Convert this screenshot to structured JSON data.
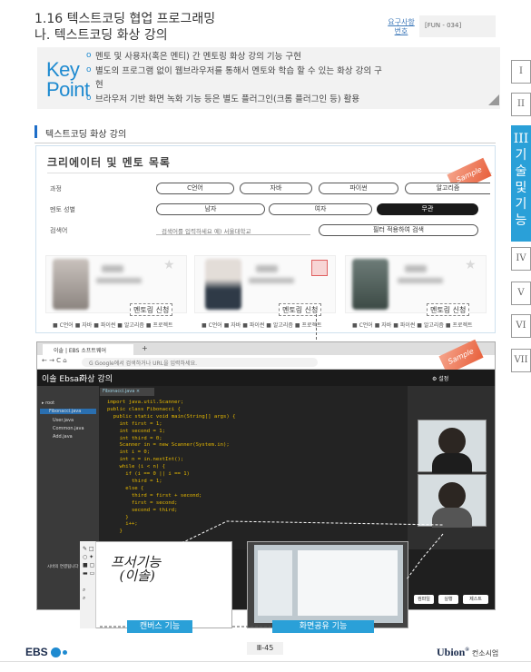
{
  "header": {
    "title": "1.16 텍스트코딩 협업 프로그래밍",
    "subtitle": "나. 텍스트코딩 화상 강의",
    "req_label": "요구사항 번호",
    "req_code": "[FUN - 034]"
  },
  "keypoint": {
    "label_line1": "Key",
    "label_line2": "Point",
    "items": [
      "멘토 및 사용자(혹은 멘티) 간 멘토링 화상 강의 기능 구현",
      "별도의 프로그램 없이 웹브라우저를 통해서 멘토와 학습 할 수 있는 화상 강의 구",
      "현",
      "브라우저 기반 화면 녹화 기능 등은 별도 플러그인(크롬 플러그인 등) 활용"
    ]
  },
  "side_tabs": {
    "t1": "I",
    "t2": "II",
    "active": "III\n기\n술\n및\n기\n능",
    "t4": "IV",
    "t5": "V",
    "t6": "VI",
    "t7": "VII"
  },
  "section": {
    "title": "텍스트코딩 화상 강의"
  },
  "mentor_list": {
    "title": "크리에이터 및 멘토 목록",
    "row_course": "과정",
    "row_gender": "멘토 성별",
    "row_search": "검색어",
    "courses": [
      "C언어",
      "자바",
      "파이썬",
      "알고리즘"
    ],
    "genders": [
      "남자",
      "여자",
      "무관"
    ],
    "search_placeholder": "검색어를 입력하세요 예) 서울대학교",
    "filter_button": "필터 적용하여 검색",
    "mentor_button": "멘토링 신청",
    "tags_prefix": "■ C언어 ■ 자바 ■ 파이썬 ■ 알고리즘 ■ 프로젝트",
    "sample": "Sample"
  },
  "browser": {
    "tab": "이솔 | EBS 소프트웨어",
    "url": "G  Google에서 검색하거나 URL을 입력하세요.",
    "app_logo": "이솔 Ebsai",
    "app_title": "화상 강의",
    "settings": "⚙ 설정",
    "editor_tab": "Fibonacci.java ×",
    "files": [
      "▸ root",
      "Fibonacci.java",
      "User.java",
      "Common.java",
      "Add.java"
    ],
    "code": "import java.util.Scanner;\npublic class Fibonacci {\n  public static void main(String[] args) {\n    int first = 1;\n    int second = 1;\n    int third = 0;\n    Scanner in = new Scanner(System.in);\n    int i = 0;\n    int n = in.nextInt();\n    while (i < n) {\n      if (i == 0 || i == 1)\n        third = 1;\n      else {\n        third = first + second;\n        first = second;\n        second = third;\n      }\n      i++;\n    }",
    "chat_label": "시바의 연결됩니다",
    "buttons": [
      "컴파일",
      "실행",
      "제스트"
    ],
    "handwriting": "프서기능\n  (이솔)"
  },
  "captions": {
    "canvas": "캔버스 기능",
    "share": "화면공유 기능"
  },
  "footer": {
    "ebs": "EBS",
    "page": "Ⅲ-45",
    "ubion": "Ubion",
    "ubion_sub": "컨소시엄"
  }
}
